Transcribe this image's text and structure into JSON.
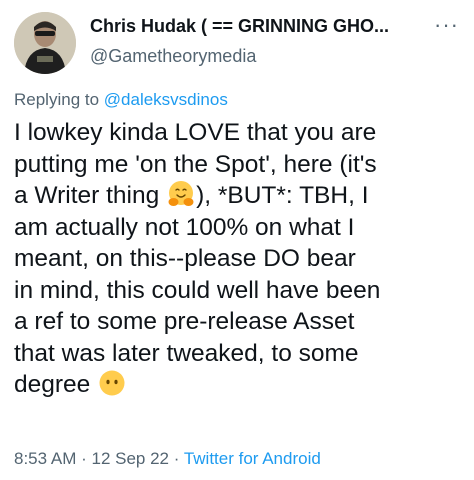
{
  "author": {
    "display_name": "Chris Hudak ( == GRINNING GHO...",
    "handle": "@Gametheorymedia"
  },
  "reply": {
    "prefix": "Replying to ",
    "to": "@daleksvsdinos"
  },
  "body": {
    "line1": "I lowkey kinda LOVE that you are",
    "line2": "putting me 'on the Spot', here (it's",
    "line3a": "a Writer thing ",
    "emoji1": "hugging-face-emoji",
    "line3b": "), *BUT*: TBH, I",
    "line4": "am actually not 100% on what I",
    "line5": "meant, on this--please DO bear",
    "line6": "in mind, this could well have been",
    "line7": "a ref to some pre-release Asset",
    "line8": "that was later tweaked, to some",
    "line9": "degree ",
    "emoji2": "face-without-mouth-emoji"
  },
  "meta": {
    "time": "8:53 AM",
    "sep1": " · ",
    "date": "12 Sep 22",
    "sep2": " · ",
    "source": "Twitter for Android"
  },
  "icons": {
    "more": "more-horizontal-icon"
  },
  "colors": {
    "text": "#0f1419",
    "secondary": "#536471",
    "link": "#1d9bf0"
  }
}
